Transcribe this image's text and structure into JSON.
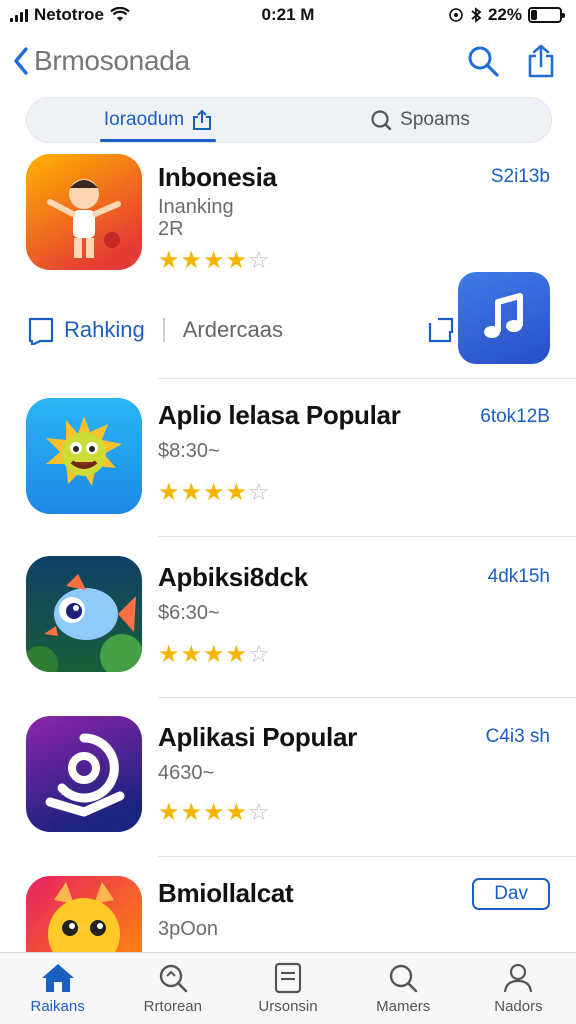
{
  "status_bar": {
    "carrier": "Netotroe",
    "time": "0:21 M",
    "battery": "22%",
    "battery_level": 0.22
  },
  "nav": {
    "title": "Brmosonada"
  },
  "segments": [
    {
      "label": "Ioraodum",
      "icon": "share-icon",
      "active": true
    },
    {
      "label": "Spoams",
      "icon": "search-icon",
      "active": false
    }
  ],
  "apps": [
    {
      "name": "Inbonesia",
      "sub1": "Inanking",
      "sub2": "2R",
      "rating": 4,
      "button": "S2i13b",
      "colors": [
        "#ffb300",
        "#e53935"
      ]
    },
    {
      "name": "Aplio lelasa Popular",
      "sub1": "$8:30~",
      "sub2": "",
      "rating": 4,
      "button": "6tok12B",
      "colors": [
        "#29b6f6",
        "#1e88e5"
      ]
    },
    {
      "name": "Apbiksi8dck",
      "sub1": "$6:30~",
      "sub2": "",
      "rating": 4,
      "button": "4dk15h",
      "colors": [
        "#0f3f66",
        "#2a8a3a"
      ]
    },
    {
      "name": "Aplikasi Popular",
      "sub1": "4630~",
      "sub2": "",
      "rating": 4,
      "button": "C4i3 sh",
      "colors": [
        "#7b1fa2",
        "#1a237e"
      ]
    },
    {
      "name": "Bmiollalcat",
      "sub1": "3pOon",
      "sub2": "",
      "rating": 0,
      "button": "Dav",
      "colors": [
        "#e91e63",
        "#ff9800"
      ]
    }
  ],
  "action_row": {
    "left_label": "Rahking",
    "right_label": "Ardercaas"
  },
  "tabs": [
    {
      "label": "Raikans",
      "icon": "home-icon",
      "active": true
    },
    {
      "label": "Rrtorean",
      "icon": "search-icon",
      "active": false
    },
    {
      "label": "Ursonsin",
      "icon": "document-icon",
      "active": false
    },
    {
      "label": "Mamers",
      "icon": "search-icon",
      "active": false
    },
    {
      "label": "Nadors",
      "icon": "person-icon",
      "active": false
    }
  ],
  "colors": {
    "accent": "#1a5fc2",
    "star": "#f4b400"
  }
}
